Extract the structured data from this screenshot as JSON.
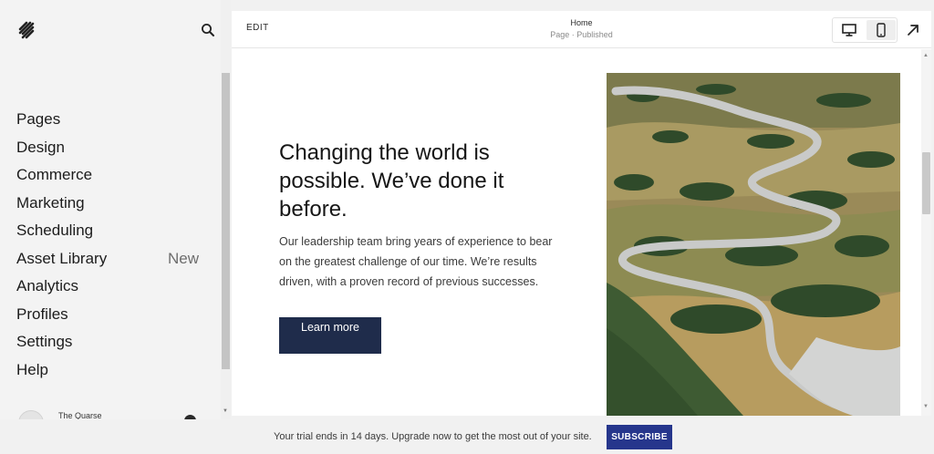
{
  "sidebar": {
    "logo_icon": "squarespace-logo-icon",
    "search_icon": "search-icon",
    "items": [
      {
        "label": "Pages"
      },
      {
        "label": "Design"
      },
      {
        "label": "Commerce"
      },
      {
        "label": "Marketing"
      },
      {
        "label": "Scheduling"
      },
      {
        "label": "Asset Library",
        "badge": "New"
      },
      {
        "label": "Analytics"
      },
      {
        "label": "Profiles"
      },
      {
        "label": "Settings"
      },
      {
        "label": "Help"
      }
    ],
    "footer": {
      "site_name": "The Quarse"
    }
  },
  "topbar": {
    "edit_label": "EDIT",
    "page_title": "Home",
    "page_status": "Page · Published",
    "view_icons": [
      "desktop-icon",
      "mobile-icon"
    ],
    "open_icon": "external-arrow-icon"
  },
  "content": {
    "headline": "Changing the world is possible. We’ve done it before.",
    "body": "Our leadership team bring years of experience to bear on the greatest challenge of our time. We’re results driven, with a proven record of previous successes.",
    "cta_label": "Learn more",
    "image_alt": "winding road through green hills"
  },
  "trial": {
    "message": "Your trial ends in 14 days. Upgrade now to get the most out of your site.",
    "subscribe_label": "SUBSCRIBE"
  },
  "colors": {
    "cta_bg": "#1f2c4b",
    "subscribe_bg": "#26368c",
    "sidebar_bg": "#f3f3f3"
  }
}
